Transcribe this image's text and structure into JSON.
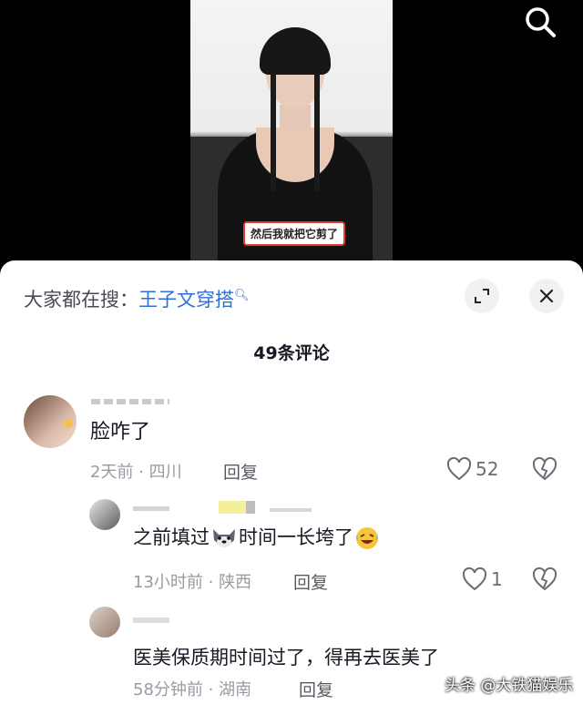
{
  "video": {
    "caption": "然后我就把它剪了"
  },
  "sheet": {
    "search_prefix": "大家都在搜：",
    "search_term": "王子文穿搭",
    "comment_count": "49条评论"
  },
  "comments": [
    {
      "text": "脸咋了",
      "time": "2天前",
      "location": "四川",
      "reply_label": "回复",
      "likes": "52"
    },
    {
      "text_before": "之前填过",
      "text_after": "时间一长垮了",
      "time": "13小时前",
      "location": "陕西",
      "reply_label": "回复",
      "likes": "1"
    },
    {
      "text": "医美保质期时间过了，得再去医美了",
      "time": "58分钟前",
      "location": "湖南",
      "reply_label": "回复"
    }
  ],
  "meta_separator": " · ",
  "watermark": "头条 @大铁猫娱乐",
  "icons": {
    "search": "search-icon",
    "expand": "expand-icon",
    "close": "close-icon",
    "like": "heart-icon",
    "dislike": "broken-heart-icon"
  },
  "colors": {
    "link": "#2f6fd8",
    "muted": "#9a9aa3",
    "text": "#161823"
  }
}
